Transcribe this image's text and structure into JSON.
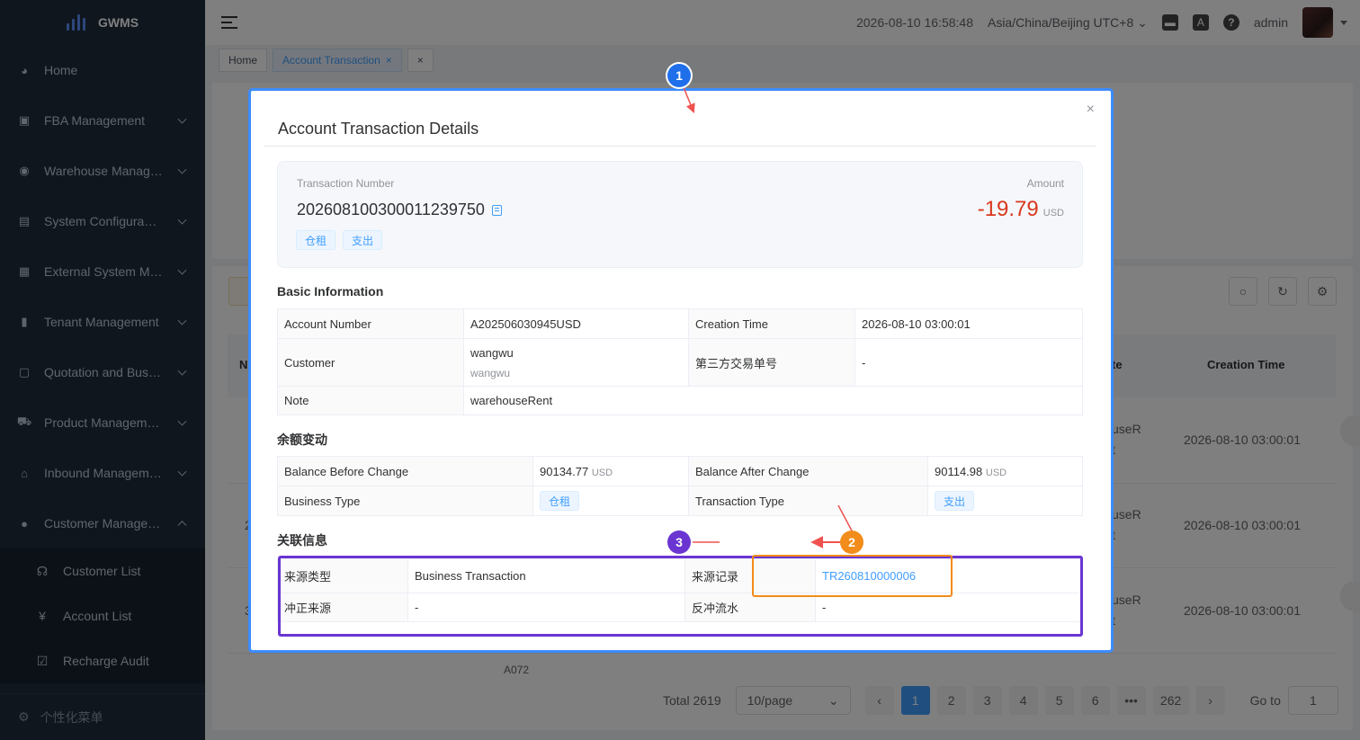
{
  "app": {
    "name": "GWMS"
  },
  "sidebar": {
    "items": [
      {
        "label": "Home",
        "icon": "dashboard-icon",
        "glyph": "◕",
        "has_children": false
      },
      {
        "label": "FBA Management",
        "icon": "document-icon",
        "glyph": "▣",
        "has_children": true
      },
      {
        "label": "Warehouse Manag…",
        "icon": "globe-icon",
        "glyph": "◉",
        "has_children": true
      },
      {
        "label": "System Configura…",
        "icon": "list-icon",
        "glyph": "▤",
        "has_children": true
      },
      {
        "label": "External System M…",
        "icon": "grid-icon",
        "glyph": "▦",
        "has_children": true
      },
      {
        "label": "Tenant Management",
        "icon": "bar-chart-icon",
        "glyph": "▮",
        "has_children": true
      },
      {
        "label": "Quotation and Bus…",
        "icon": "quote-icon",
        "glyph": "▢",
        "has_children": true
      },
      {
        "label": "Product Managem…",
        "icon": "cart-icon",
        "glyph": "⛟",
        "has_children": true
      },
      {
        "label": "Inbound Managem…",
        "icon": "house-icon",
        "glyph": "⌂",
        "has_children": true
      }
    ],
    "expanded": {
      "label": "Customer Manage…",
      "icon": "user-icon",
      "glyph": "●"
    },
    "sub_items": [
      {
        "label": "Customer List",
        "icon": "headset-icon",
        "glyph": "☊"
      },
      {
        "label": "Account List",
        "icon": "yen-icon",
        "glyph": "¥"
      },
      {
        "label": "Recharge Audit",
        "icon": "checkbox-icon",
        "glyph": "☑"
      }
    ],
    "footer": {
      "label": "个性化菜单",
      "glyph": "⚙"
    }
  },
  "header": {
    "datetime": "2026-08-10 16:58:48",
    "timezone": "Asia/China/Beijing UTC+8",
    "user": "admin"
  },
  "tabs": [
    {
      "label": "Home",
      "active": false
    },
    {
      "label": "Account Transaction",
      "active": true,
      "close": "×"
    },
    {
      "label": "×",
      "active": false
    }
  ],
  "background_table": {
    "headers": {
      "n": "N",
      "te": "te",
      "creation_time": "Creation Time"
    },
    "rows": [
      {
        "partial": "useR",
        "partial2": "t",
        "time": "2026-08-10 03:00:01"
      },
      {
        "partial": "useR",
        "partial2": "t",
        "time": "2026-08-10 03:00:01"
      },
      {
        "partial": "useR",
        "partial2": "t",
        "time": "2026-08-10 03:00:01"
      }
    ],
    "row_prefix": [
      "2",
      "3"
    ],
    "bottom_partial": "A072"
  },
  "pagination": {
    "total": "Total 2619",
    "page_size": "10/page",
    "prev": "‹",
    "next": "›",
    "pages": [
      "1",
      "2",
      "3",
      "4",
      "5",
      "6",
      "•••",
      "262"
    ],
    "active_page": "1",
    "goto_label": "Go to",
    "goto_value": "1"
  },
  "dialog": {
    "title": "Account Transaction Details",
    "close": "×",
    "summary": {
      "txn_label": "Transaction Number",
      "txn_number": "202608100300011239750",
      "amount_label": "Amount",
      "amount": "-19.79",
      "currency": "USD",
      "tags": [
        "仓租",
        "支出"
      ]
    },
    "basic": {
      "title": "Basic Information",
      "account_number_label": "Account Number",
      "account_number": "A202506030945USD",
      "creation_time_label": "Creation Time",
      "creation_time": "2026-08-10 03:00:01",
      "customer_label": "Customer",
      "customer_name": "wangwu",
      "customer_sub": "wangwu",
      "third_party_label": "第三方交易单号",
      "third_party": "-",
      "note_label": "Note",
      "note": "warehouseRent"
    },
    "balance": {
      "title": "余额变动",
      "before_label": "Balance Before Change",
      "before_value": "90134.77",
      "before_unit": "USD",
      "after_label": "Balance After Change",
      "after_value": "90114.98",
      "after_unit": "USD",
      "business_type_label": "Business Type",
      "business_type": "仓租",
      "transaction_type_label": "Transaction Type",
      "transaction_type": "支出"
    },
    "related": {
      "title": "关联信息",
      "source_type_label": "来源类型",
      "source_type": "Business Transaction",
      "source_record_label": "来源记录",
      "source_record": "TR260810000006",
      "reversal_source_label": "冲正来源",
      "reversal_source": "-",
      "reversal_flow_label": "反冲流水",
      "reversal_flow": "-"
    }
  },
  "annotations": [
    {
      "label": "1",
      "color": "#1f6feb"
    },
    {
      "label": "2",
      "color": "#f28c1a"
    },
    {
      "label": "3",
      "color": "#6a35d1"
    }
  ],
  "colors": {
    "accent": "#409eff",
    "negative": "#d9381e",
    "sidebar": "#1f2d3d",
    "annotation_arrow": "#f0524f"
  }
}
